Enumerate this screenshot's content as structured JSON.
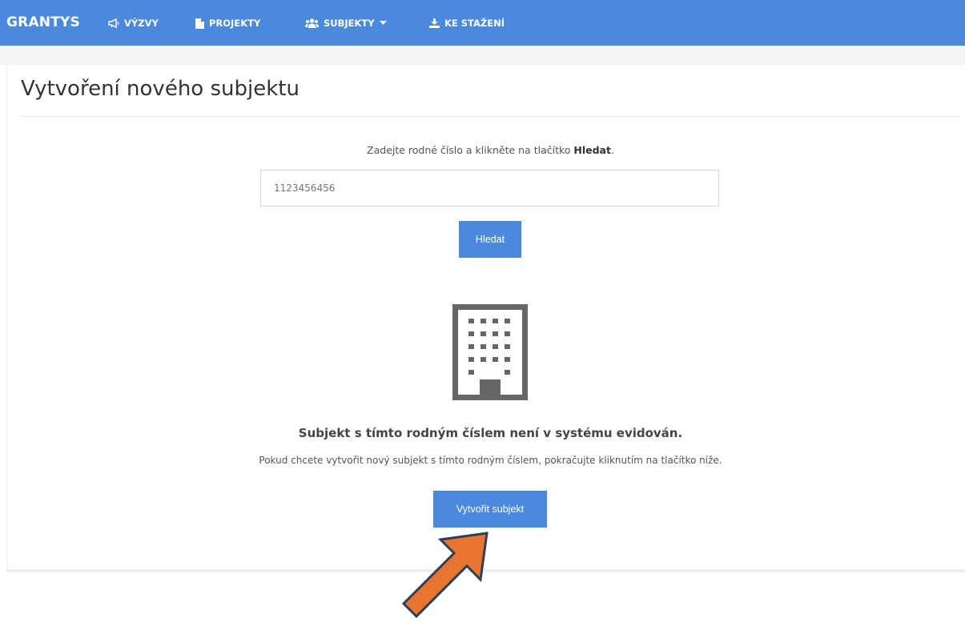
{
  "nav": {
    "brand": "GRANTYS",
    "items": [
      {
        "label": "VÝZVY",
        "icon": "megaphone-icon"
      },
      {
        "label": "PROJEKTY",
        "icon": "file-icon"
      },
      {
        "label": "SUBJEKTY",
        "icon": "users-icon",
        "dropdown": true
      },
      {
        "label": "KE STAŽENÍ",
        "icon": "download-icon"
      }
    ]
  },
  "page": {
    "title": "Vytvoření nového subjektu"
  },
  "search": {
    "instruction_prefix": "Zadejte rodné číslo a klikněte na tlačítko ",
    "instruction_bold": "Hledat",
    "instruction_suffix": ".",
    "value": "1123456456",
    "button_label": "Hledat"
  },
  "result": {
    "icon": "building-icon",
    "title": "Subjekt s tímto rodným číslem není v systému evidován.",
    "subtitle": "Pokud chcete vytvořit nový subjekt s tímto rodným číslem, pokračujte kliknutím na tlačítko níže.",
    "button_label": "Vytvořit subjekt"
  },
  "annotation": {
    "icon": "arrow-pointer-icon",
    "color": "#e8752f"
  },
  "colors": {
    "primary": "#4a89dc",
    "icon_gray": "#666666"
  }
}
